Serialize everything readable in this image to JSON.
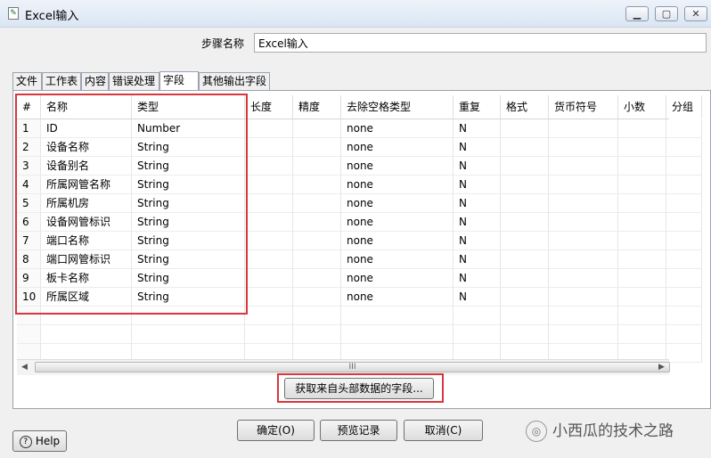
{
  "window": {
    "title": "Excel输入",
    "icon": "excel-document-icon",
    "controls": [
      "minimize",
      "maximize",
      "close"
    ]
  },
  "step": {
    "label": "步骤名称",
    "value": "Excel输入"
  },
  "tabs": [
    {
      "label": "文件",
      "active": false
    },
    {
      "label": "工作表",
      "active": false
    },
    {
      "label": "内容",
      "active": false
    },
    {
      "label": "错误处理",
      "active": false
    },
    {
      "label": "字段",
      "active": true
    },
    {
      "label": "其他输出字段",
      "active": false
    }
  ],
  "table": {
    "columns": [
      "#",
      "名称",
      "类型",
      "长度",
      "精度",
      "去除空格类型",
      "重复",
      "格式",
      "货币符号",
      "小数",
      "分组"
    ],
    "rows": [
      [
        "1",
        "ID",
        "Number",
        "",
        "",
        "none",
        "N",
        "",
        "",
        "",
        ""
      ],
      [
        "2",
        "设备名称",
        "String",
        "",
        "",
        "none",
        "N",
        "",
        "",
        "",
        ""
      ],
      [
        "3",
        "设备别名",
        "String",
        "",
        "",
        "none",
        "N",
        "",
        "",
        "",
        ""
      ],
      [
        "4",
        "所属网管名称",
        "String",
        "",
        "",
        "none",
        "N",
        "",
        "",
        "",
        ""
      ],
      [
        "5",
        "所属机房",
        "String",
        "",
        "",
        "none",
        "N",
        "",
        "",
        "",
        ""
      ],
      [
        "6",
        "设备网管标识",
        "String",
        "",
        "",
        "none",
        "N",
        "",
        "",
        "",
        ""
      ],
      [
        "7",
        "端口名称",
        "String",
        "",
        "",
        "none",
        "N",
        "",
        "",
        "",
        ""
      ],
      [
        "8",
        "端口网管标识",
        "String",
        "",
        "",
        "none",
        "N",
        "",
        "",
        "",
        ""
      ],
      [
        "9",
        "板卡名称",
        "String",
        "",
        "",
        "none",
        "N",
        "",
        "",
        "",
        ""
      ],
      [
        "10",
        "所属区域",
        "String",
        "",
        "",
        "none",
        "N",
        "",
        "",
        "",
        ""
      ]
    ],
    "empty_rows": 3
  },
  "scroll_grip": "III",
  "buttons": {
    "get_fields": "获取来自头部数据的字段...",
    "ok": "确定(O)",
    "preview": "预览记录",
    "cancel": "取消(C)",
    "help": "Help"
  },
  "watermark": "小西瓜的技术之路",
  "colors": {
    "highlight_box": "#d9363e",
    "titlebar": "#dbe6f3"
  }
}
